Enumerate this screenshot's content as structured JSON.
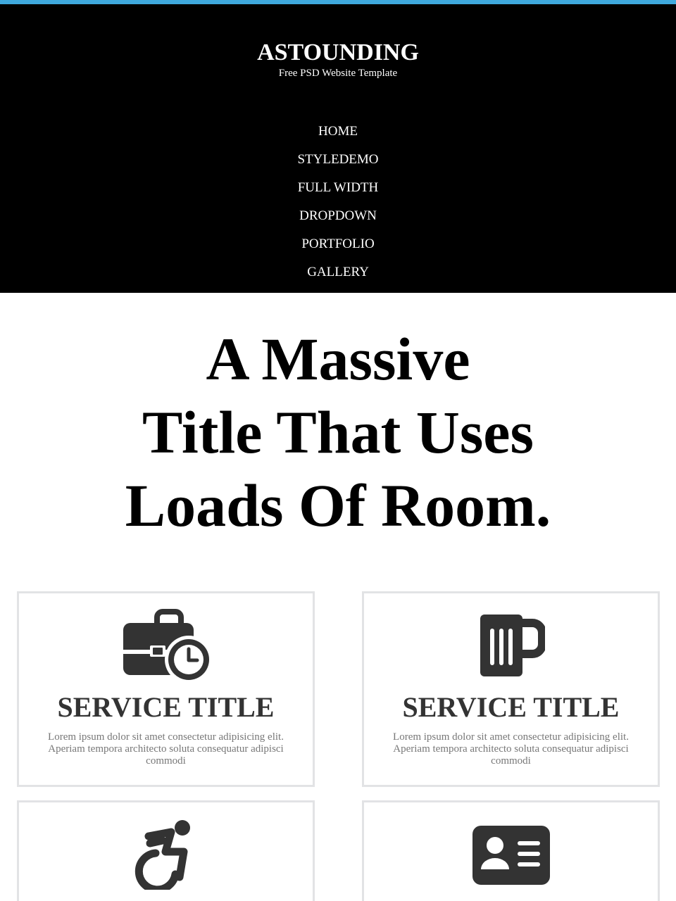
{
  "site": {
    "logo": "ASTOUNDING",
    "tagline": "Free PSD Website Template"
  },
  "nav": {
    "items": [
      "HOME",
      "STYLEDEMO",
      "FULL WIDTH",
      "DROPDOWN",
      "PORTFOLIO",
      "GALLERY"
    ]
  },
  "hero": {
    "lines": [
      "A Massive",
      "Title That Uses",
      "Loads Of Room."
    ]
  },
  "services": [
    {
      "icon": "briefcase-clock-icon",
      "title": "SERVICE TITLE",
      "description": "Lorem ipsum dolor sit amet consectetur adipisicing elit. Aperiam tempora architecto soluta consequatur adipisci commodi"
    },
    {
      "icon": "beer-mug-icon",
      "title": "SERVICE TITLE",
      "description": "Lorem ipsum dolor sit amet consectetur adipisicing elit. Aperiam tempora architecto soluta consequatur adipisci commodi"
    },
    {
      "icon": "wheelchair-icon"
    },
    {
      "icon": "id-card-icon"
    }
  ],
  "colors": {
    "accent": "#3fa9dd",
    "header_bg": "#000000",
    "icon": "#333333",
    "card_border": "#e2e3e5",
    "body_text": "#777777"
  }
}
